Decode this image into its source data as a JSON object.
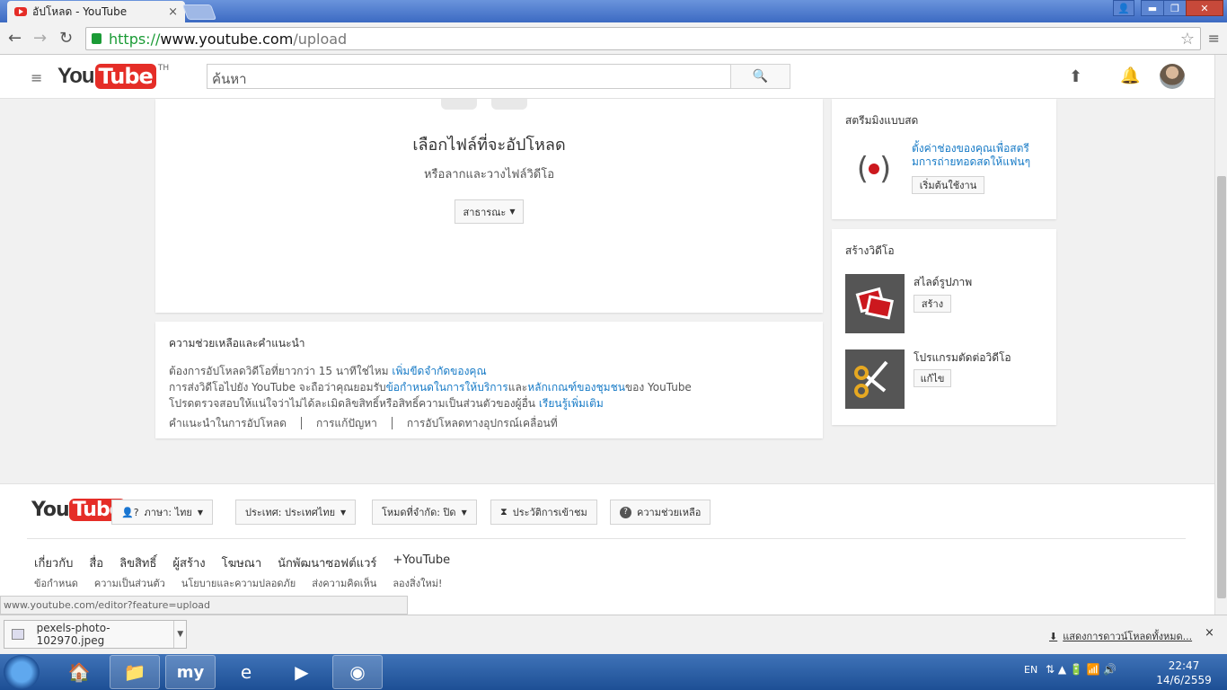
{
  "browser": {
    "tab_title": "อัปโหลด - YouTube",
    "tab_close": "×",
    "url_scheme": "https://",
    "url_host": "www.youtube.com",
    "url_path": "/upload",
    "window_buttons": [
      "▬",
      "❐",
      "✕"
    ],
    "status_url": "www.youtube.com/editor?feature=upload"
  },
  "header": {
    "logo_you": "You",
    "logo_tube": "Tube",
    "logo_region": "TH",
    "search_placeholder": "ค้นหา"
  },
  "upload": {
    "title": "เลือกไฟล์ที่จะอัปโหลด",
    "subtitle": "หรือลากและวางไฟล์วิดีโอ",
    "privacy_label": "สาธารณะ"
  },
  "help": {
    "heading": "ความช่วยเหลือและคำแนะนำ",
    "line1_text": "ต้องการอัปโหลดวิดีโอที่ยาวกว่า 15 นาทีใช่ไหม ",
    "line1_link": "เพิ่มขีดจำกัดของคุณ",
    "line2_text_a": "การส่งวิดีโอไปยัง YouTube จะถือว่าคุณยอมรับ",
    "line2_link_a": "ข้อกำหนดในการให้บริการ",
    "line2_text_b": "และ",
    "line2_link_b": "หลักเกณฑ์ของชุมชน",
    "line2_text_c": "ของ YouTube",
    "line3_text": "โปรดตรวจสอบให้แน่ใจว่าไม่ได้ละเมิดลิขสิทธิ์หรือสิทธิ์ความเป็นส่วนตัวของผู้อื่น ",
    "line3_link": "เรียนรู้เพิ่มเติม",
    "links": [
      "คำแนะนำในการอัปโหลด",
      "การแก้ปัญหา",
      "การอัปโหลดทางอุปกรณ์เคลื่อนที่"
    ]
  },
  "live": {
    "heading": "สตรีมมิงแบบสด",
    "description": "ตั้งค่าช่องของคุณเพื่อสตรีมการถ่ายทอดสดให้แฟนๆ",
    "button": "เริ่มต้นใช้งาน"
  },
  "create": {
    "heading": "สร้างวิดีโอ",
    "items": [
      {
        "title": "สไลด์รูปภาพ",
        "button": "สร้าง"
      },
      {
        "title": "โปรแกรมตัดต่อวิดีโอ",
        "button": "แก้ไข"
      }
    ]
  },
  "footer": {
    "language": "ภาษา: ไทย",
    "country": "ประเทศ: ประเทศไทย",
    "restricted": "โหมดที่จำกัด: ปิด",
    "history": "ประวัติการเข้าชม",
    "help": "ความช่วยเหลือ",
    "nav": [
      "เกี่ยวกับ",
      "สื่อ",
      "ลิขสิทธิ์",
      "ผู้สร้าง",
      "โฆษณา",
      "นักพัฒนาซอฟต์แวร์",
      "+YouTube"
    ],
    "sub": [
      "ข้อกำหนด",
      "ความเป็นส่วนตัว",
      "นโยบายและความปลอดภัย",
      "ส่งความคิดเห็น",
      "ลองสิ่งใหม่!"
    ]
  },
  "downloads": {
    "file": "pexels-photo-102970.jpeg",
    "show_all": "แสดงการดาวน์โหลดทั้งหมด...",
    "close": "×"
  },
  "taskbar": {
    "language": "EN",
    "time": "22:47",
    "date": "14/6/2559",
    "apps": [
      "home-icon",
      "file-explorer-icon",
      "my-icon",
      "internet-explorer-icon",
      "media-player-icon",
      "chrome-icon"
    ],
    "my_label": "my"
  },
  "colors": {
    "youtube_red": "#e52d27",
    "link_blue": "#167ac6",
    "secure_green": "#1b9b36"
  }
}
